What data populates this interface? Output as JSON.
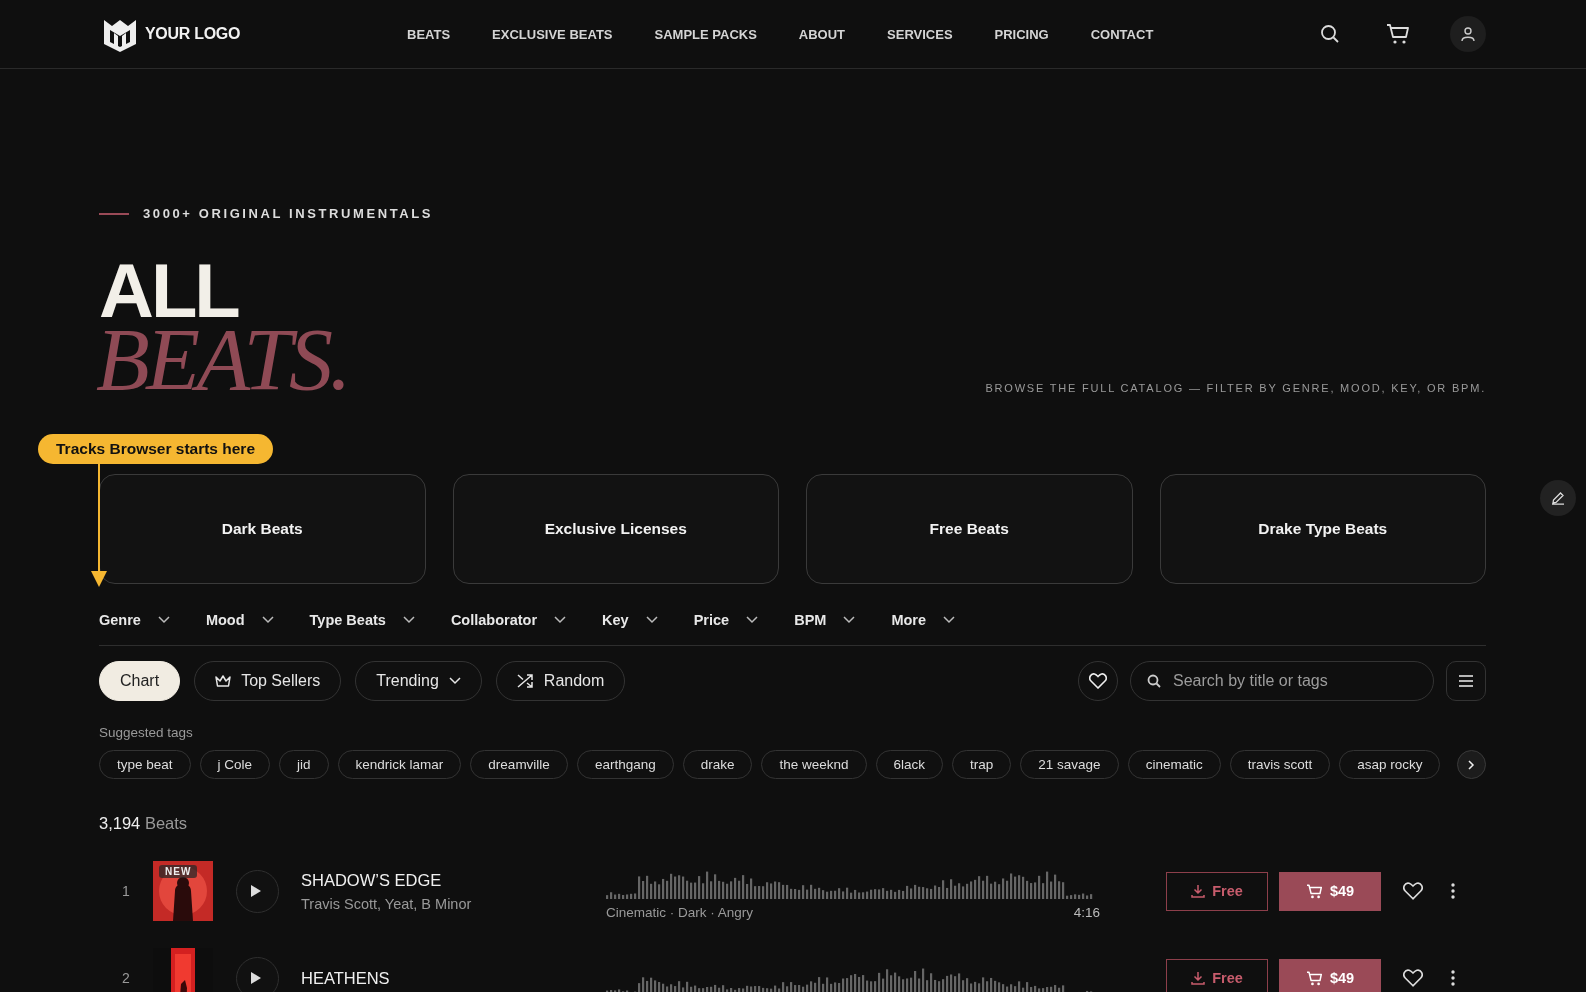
{
  "nav": {
    "logo": "YOUR LOGO",
    "links": [
      "BEATS",
      "EXCLUSIVE BEATS",
      "SAMPLE PACKS",
      "ABOUT",
      "SERVICES",
      "PRICING",
      "CONTACT"
    ]
  },
  "hero": {
    "eyebrow": "3000+ ORIGINAL INSTRUMENTALS",
    "title_line1": "ALL",
    "title_line2": "BEATS.",
    "subtitle": "BROWSE THE FULL CATALOG — FILTER BY GENRE, MOOD, KEY, OR BPM."
  },
  "callout": {
    "text": "Tracks Browser starts here"
  },
  "categories": [
    "Dark Beats",
    "Exclusive Licenses",
    "Free Beats",
    "Drake Type Beats"
  ],
  "filters": [
    "Genre",
    "Mood",
    "Type Beats",
    "Collaborator",
    "Key",
    "Price",
    "BPM",
    "More"
  ],
  "sort_buttons": [
    {
      "label": "Chart",
      "kind": "plain",
      "selected": true
    },
    {
      "label": "Top Sellers",
      "kind": "crown",
      "selected": false
    },
    {
      "label": "Trending",
      "kind": "dropdown",
      "selected": false
    },
    {
      "label": "Random",
      "kind": "shuffle",
      "selected": false
    }
  ],
  "search": {
    "placeholder": "Search by title or tags"
  },
  "suggested_tags": {
    "label": "Suggested tags",
    "items": [
      "type beat",
      "j Cole",
      "jid",
      "kendrick lamar",
      "dreamville",
      "earthgang",
      "drake",
      "the weeknd",
      "6lack",
      "trap",
      "21 savage",
      "cinematic",
      "travis scott",
      "asap rocky"
    ]
  },
  "count": "**3,194** Beats",
  "tracks": [
    {
      "number": "1",
      "badge": "NEW",
      "title": "SHADOW’S EDGE",
      "subtitle": "Travis Scott, Yeat, B Minor",
      "tags": "Cinematic · Dark · Angry",
      "duration": "4:16",
      "free_label": "Free",
      "price": "$49"
    },
    {
      "number": "2",
      "title": "HEATHENS",
      "free_label": "Free",
      "price": "$49"
    }
  ]
}
